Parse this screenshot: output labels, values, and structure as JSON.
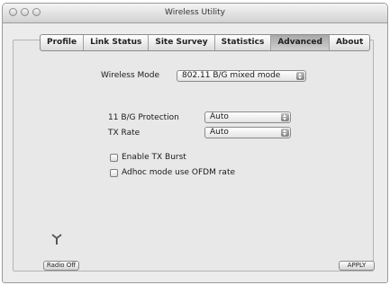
{
  "window": {
    "title": "Wireless Utility"
  },
  "tabs": [
    {
      "label": "Profile",
      "active": false
    },
    {
      "label": "Link Status",
      "active": false
    },
    {
      "label": "Site Survey",
      "active": false
    },
    {
      "label": "Statistics",
      "active": false
    },
    {
      "label": "Advanced",
      "active": true
    },
    {
      "label": "About",
      "active": false
    }
  ],
  "advanced": {
    "wireless_mode": {
      "label": "Wireless Mode",
      "value": "802.11 B/G mixed mode"
    },
    "bg_protection": {
      "label": "11 B/G Protection",
      "value": "Auto"
    },
    "tx_rate": {
      "label": "TX Rate",
      "value": "Auto"
    },
    "tx_burst": {
      "label": "Enable TX Burst",
      "checked": false
    },
    "adhoc_ofdm": {
      "label": "Adhoc mode use OFDM rate",
      "checked": false
    }
  },
  "footer": {
    "radio_label": "Radio Off",
    "apply_label": "APPLY",
    "antenna_icon": "antenna-icon"
  }
}
